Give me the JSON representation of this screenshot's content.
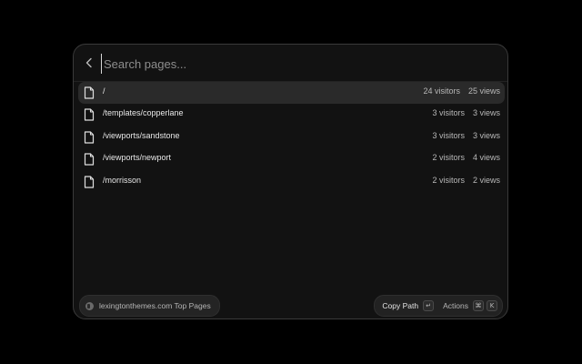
{
  "search": {
    "placeholder": "Search pages..."
  },
  "pages": [
    {
      "path": "/",
      "visitors": "24 visitors",
      "views": "25 views",
      "active": true
    },
    {
      "path": "/templates/copperlane",
      "visitors": "3 visitors",
      "views": "3 views"
    },
    {
      "path": "/viewports/sandstone",
      "visitors": "3 visitors",
      "views": "3 views"
    },
    {
      "path": "/viewports/newport",
      "visitors": "2 visitors",
      "views": "4 views"
    },
    {
      "path": "/morrisson",
      "visitors": "2 visitors",
      "views": "2 views"
    }
  ],
  "footer": {
    "source_label": "lexingtonthemes.com Top Pages",
    "primary_action": "Copy Path",
    "primary_key": "↵",
    "actions_label": "Actions",
    "actions_keys": [
      "⌘",
      "K"
    ]
  },
  "icons": {
    "back": "chevron-left-icon",
    "page": "file-icon",
    "site": "site-favicon-icon"
  }
}
